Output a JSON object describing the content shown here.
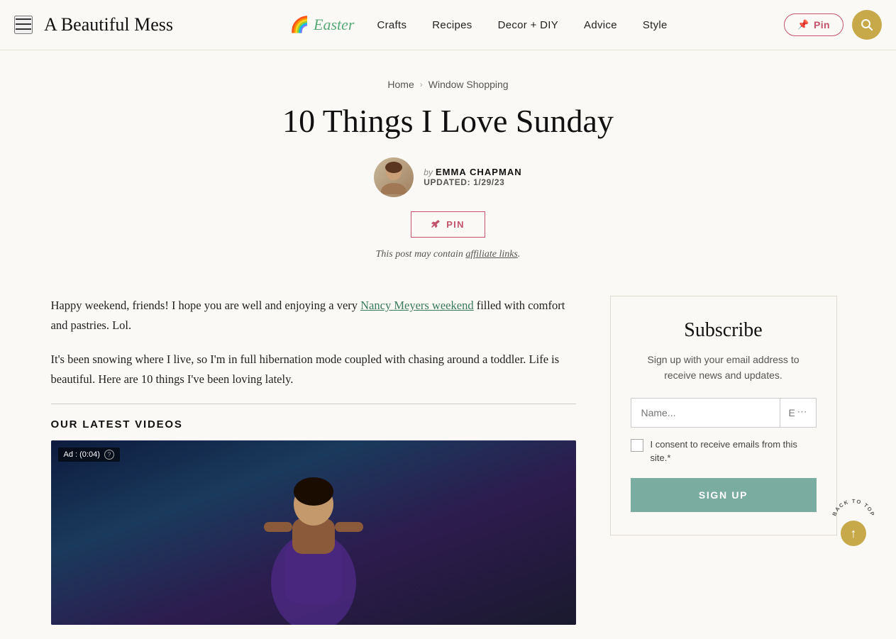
{
  "header": {
    "hamburger_label": "☰",
    "site_logo": "A Beautiful Mess",
    "easter_logo": "🌈",
    "easter_text": "Easter",
    "nav": [
      {
        "label": "Crafts",
        "href": "#"
      },
      {
        "label": "Recipes",
        "href": "#"
      },
      {
        "label": "Decor + DIY",
        "href": "#"
      },
      {
        "label": "Advice",
        "href": "#"
      },
      {
        "label": "Style",
        "href": "#"
      }
    ],
    "pin_button_label": "Pin",
    "pin_icon": "📌",
    "search_icon": "🔍"
  },
  "breadcrumb": {
    "home": "Home",
    "separator": "›",
    "current": "Window Shopping"
  },
  "article": {
    "title": "10 Things I Love Sunday",
    "author_by": "by",
    "author_name": "EMMA CHAPMAN",
    "updated_label": "UPDATED:",
    "updated_date": "1/29/23",
    "pin_button_label": "PIN",
    "affiliate_notice": "This post may contain affiliate links.",
    "affiliate_link_text": "affiliate links"
  },
  "body": {
    "paragraph1": "Happy weekend, friends! I hope you are well and enjoying a very Nancy Meyers weekend filled with comfort and pastries. Lol.",
    "paragraph1_link_text": "Nancy Meyers weekend",
    "paragraph2": "It's been snowing where I live, so I'm in full hibernation mode coupled with chasing around a toddler. Life is beautiful. Here are 10 things I've been loving lately.",
    "video_section_title": "OUR LATEST VIDEOS",
    "ad_badge": "Ad : (0:04)",
    "ad_help": "?"
  },
  "sidebar": {
    "subscribe_title": "Subscribe",
    "subscribe_desc": "Sign up with your email address to receive news and updates.",
    "name_placeholder": "Name...",
    "email_placeholder": "Email...",
    "consent_text": "I consent to receive emails from this site.*",
    "sign_up_label": "SIGN UP"
  },
  "back_to_top": {
    "label_line1": "BACK TO TOP",
    "arrow": "↑"
  },
  "colors": {
    "accent_red": "#c2536a",
    "accent_gold": "#c8a94a",
    "accent_teal": "#7aada0",
    "link_green": "#3a7a5c",
    "bg": "#faf9f5"
  }
}
